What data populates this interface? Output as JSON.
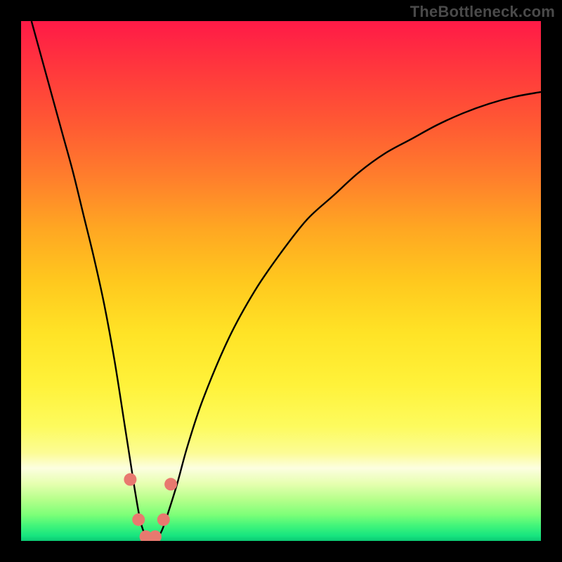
{
  "watermark": "TheBottleneck.com",
  "colors": {
    "frame": "#000000",
    "curve_stroke": "#000000",
    "marker_fill": "#e8796f",
    "marker_stroke": "#c95a53"
  },
  "chart_data": {
    "type": "line",
    "title": "",
    "xlabel": "",
    "ylabel": "",
    "xlim": [
      0,
      100
    ],
    "ylim": [
      0,
      110
    ],
    "grid": false,
    "legend": false,
    "series": [
      {
        "name": "bottleneck-curve",
        "x": [
          2,
          4,
          6,
          8,
          10,
          12,
          14,
          16,
          18,
          20,
          21,
          22,
          23,
          24,
          25,
          26,
          27,
          28,
          30,
          32,
          35,
          40,
          45,
          50,
          55,
          60,
          65,
          70,
          75,
          80,
          85,
          90,
          95,
          100
        ],
        "y": [
          110,
          102,
          94,
          86,
          78,
          69,
          60,
          50,
          38,
          24,
          17,
          10,
          4,
          1,
          0,
          0.5,
          2,
          5,
          12,
          20,
          30,
          43,
          53,
          61,
          68,
          73,
          78,
          82,
          85,
          88,
          90.5,
          92.5,
          94,
          95
        ]
      }
    ],
    "markers": [
      {
        "x": 21.0,
        "y": 13.0
      },
      {
        "x": 22.6,
        "y": 4.5
      },
      {
        "x": 24.0,
        "y": 0.9
      },
      {
        "x": 25.8,
        "y": 0.9
      },
      {
        "x": 27.4,
        "y": 4.5
      },
      {
        "x": 28.8,
        "y": 12.0
      }
    ]
  }
}
